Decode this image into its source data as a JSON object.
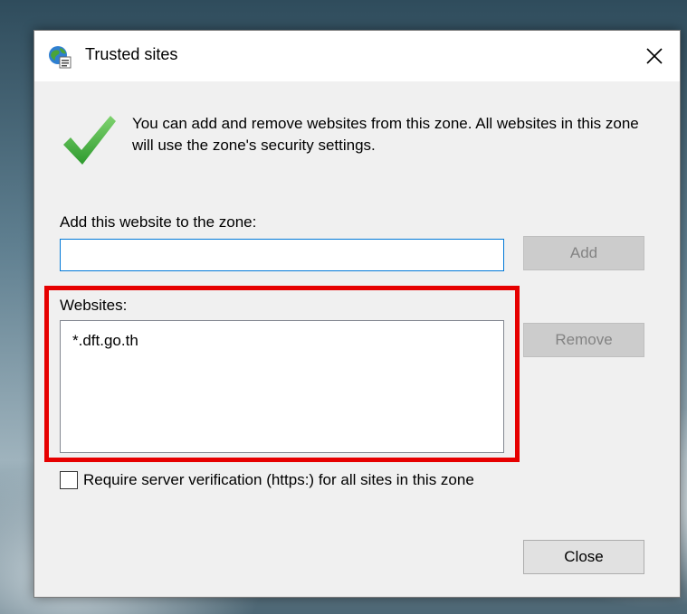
{
  "dialog": {
    "title": "Trusted sites",
    "icons": {
      "title": "globe-icon",
      "close": "close-icon",
      "info": "checkmark-icon"
    }
  },
  "info": {
    "text": "You can add and remove websites from this zone. All websites in this zone will use the zone's security settings."
  },
  "add": {
    "label": "Add this website to the zone:",
    "input_value": "",
    "button_label": "Add",
    "button_enabled": false
  },
  "websites": {
    "label": "Websites:",
    "items": [
      "*.dft.go.th"
    ],
    "remove_label": "Remove",
    "remove_enabled": false
  },
  "require_https": {
    "label": "Require server verification (https:) for all sites in this zone",
    "checked": false
  },
  "footer": {
    "close_label": "Close"
  },
  "colors": {
    "highlight": "#e60000",
    "input_focus": "#0078d7",
    "check_green": "#3dab3d"
  }
}
